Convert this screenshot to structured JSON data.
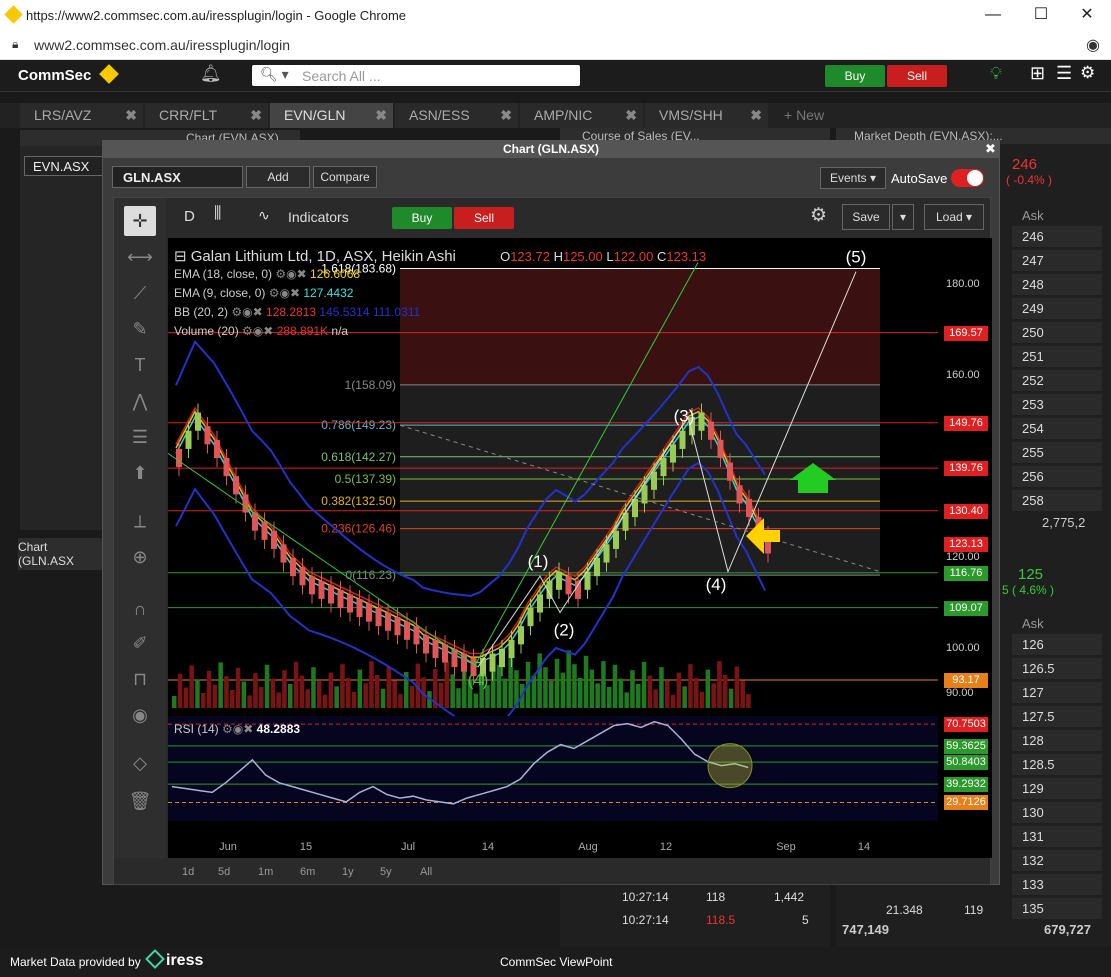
{
  "browser": {
    "title": "https://www2.commsec.com.au/iressplugin/login - Google Chrome",
    "url": "www2.commsec.com.au/iressplugin/login"
  },
  "app": {
    "logo": "CommSec",
    "search_placeholder": "Search All ...",
    "buy": "Buy",
    "sell": "Sell"
  },
  "tabs": [
    "LRS/AVZ",
    "CRR/FLT",
    "EVN/GLN",
    "ASN/ESS",
    "AMP/NIC",
    "VMS/SHH",
    "+ New"
  ],
  "left_panel": {
    "title": "Chart (EVN.ASX)",
    "symbol": "EVN.ASX",
    "bottom": "Chart (GLN.ASX"
  },
  "cos": {
    "title": "Course of Sales (EV...",
    "rows": [
      {
        "time": "10:27:14",
        "price": "118",
        "vol": "1,442"
      },
      {
        "time": "10:27:14",
        "price": "118.5",
        "vol": "5"
      }
    ]
  },
  "depth": {
    "title": "Market Depth (EVN.ASX):...",
    "price": "246",
    "change": "( -0.4% )",
    "ask_label": "Ask",
    "asks": [
      "246",
      "247",
      "248",
      "249",
      "250",
      "251",
      "252",
      "253",
      "254",
      "255",
      "256",
      "258"
    ],
    "total": "2,775,2",
    "price2": "125",
    "change2": "5 ( 4.6% )",
    "ask_label2": "Ask",
    "asks2": [
      "126",
      "126.5",
      "127",
      "127.5",
      "128",
      "128.5",
      "129",
      "130",
      "131",
      "132",
      "133",
      "135"
    ],
    "last_row": {
      "a": "21.348",
      "b": "119"
    },
    "totals": {
      "left": "747,149",
      "right": "679,727"
    }
  },
  "chart_window": {
    "title": "Chart (GLN.ASX)",
    "symbol": "GLN.ASX",
    "add": "Add",
    "compare": "Compare",
    "events": "Events",
    "autosave": "AutoSave",
    "interval": "D",
    "indicators": "Indicators",
    "buy": "Buy",
    "sell": "Sell",
    "save": "Save",
    "load": "Load"
  },
  "legend": {
    "name": "Galan Lithium Ltd, 1D, ASX, Heikin Ashi",
    "o": "O",
    "o_val": "123.72",
    "h": "H",
    "h_val": "125.00",
    "l": "L",
    "l_val": "122.00",
    "c": "C",
    "c_val": "123.13",
    "ema18": "EMA (18, close, 0)",
    "ema18_val": "126.6068",
    "ema9": "EMA (9, close, 0)",
    "ema9_val": "127.4432",
    "bb": "BB (20, 2)",
    "bb1": "128.2813",
    "bb2": "145.5314",
    "bb3": "111.0311",
    "vol": "Volume (20)",
    "vol_val": "288.891K",
    "vol_na": "n/a",
    "rsi": "RSI (14)",
    "rsi_val": "48.2883"
  },
  "fib": [
    "1.618(183.68)",
    "1(158.09)",
    "0.786(149.23)",
    "0.618(142.27)",
    "0.5(137.39)",
    "0.382(132.50)",
    "0.236(126.46)",
    "0(116.23)"
  ],
  "waves": [
    "(1)",
    "(2)",
    "(3)",
    "(4)",
    "(5)",
    "(4)"
  ],
  "chart_data": {
    "type": "candlestick",
    "ylim": [
      87,
      186
    ],
    "y_ticks": [
      "180.00",
      "160.00",
      "150.00",
      "120.00",
      "100.00",
      "90.00"
    ],
    "price_tags": [
      {
        "v": "169.57",
        "c": "#e02020"
      },
      {
        "v": "149.76",
        "c": "#e02020"
      },
      {
        "v": "139.76",
        "c": "#e02020"
      },
      {
        "v": "130.40",
        "c": "#e02020"
      },
      {
        "v": "123.13",
        "c": "#e02020"
      },
      {
        "v": "116.76",
        "c": "#2a9a2a"
      },
      {
        "v": "109.07",
        "c": "#2a9a2a"
      },
      {
        "v": "93.17",
        "c": "#e8801a"
      }
    ],
    "rsi_tags": [
      {
        "v": "70.7503",
        "c": "#e02020"
      },
      {
        "v": "59.3625",
        "c": "#2a9a2a"
      },
      {
        "v": "50.8403",
        "c": "#2a9a2a"
      },
      {
        "v": "39.2932",
        "c": "#2a9a2a"
      },
      {
        "v": "29.7126",
        "c": "#e8801a"
      }
    ],
    "x_ticks": [
      "Jun",
      "15",
      "Jul",
      "14",
      "Aug",
      "12",
      "Sep",
      "14"
    ]
  },
  "ranges": [
    "1d",
    "5d",
    "1m",
    "6m",
    "1y",
    "5y",
    "All"
  ],
  "footer": {
    "provider": "Market Data provided by",
    "brand": "iress",
    "center": "CommSec ViewPoint"
  }
}
